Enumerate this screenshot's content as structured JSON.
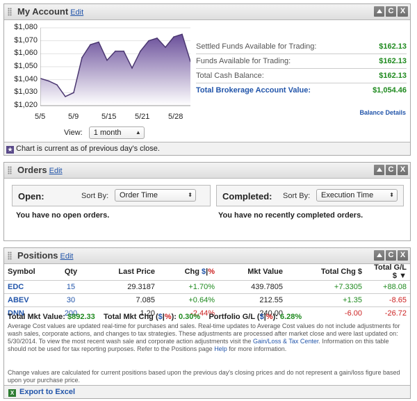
{
  "account": {
    "title": "My Account",
    "edit": "Edit",
    "chart_data": {
      "type": "area",
      "x": [
        "5/5",
        "5/6",
        "5/7",
        "5/8",
        "5/9",
        "5/12",
        "5/13",
        "5/14",
        "5/15",
        "5/16",
        "5/19",
        "5/20",
        "5/21",
        "5/22",
        "5/23",
        "5/27",
        "5/28",
        "5/29",
        "5/30"
      ],
      "values": [
        1041,
        1039,
        1036,
        1027,
        1030,
        1057,
        1067,
        1069,
        1055,
        1062,
        1062,
        1049,
        1062,
        1070,
        1072,
        1065,
        1073,
        1075,
        1054
      ],
      "ylim": [
        1020,
        1080
      ],
      "ytick_labels": [
        "$1,080",
        "$1,070",
        "$1,060",
        "$1,050",
        "$1,040",
        "$1,030",
        "$1,020"
      ],
      "xtick_labels": [
        "5/5",
        "5/9",
        "5/15",
        "5/21",
        "5/28"
      ],
      "fill_color": "#6a4f9a",
      "grid": true
    },
    "view_label": "View:",
    "view_value": "1 month",
    "balances": [
      {
        "label": "Settled Funds Available for Trading:",
        "value": "$162.13"
      },
      {
        "label": "Funds Available for Trading:",
        "value": "$162.13"
      },
      {
        "label": "Total Cash Balance:",
        "value": "$162.13"
      }
    ],
    "total_label": "Total Brokerage Account Value:",
    "total_value": "$1,054.46",
    "balance_details": "Balance Details",
    "footnote": "Chart is current as of previous day's close."
  },
  "orders": {
    "title": "Orders",
    "edit": "Edit",
    "open_label": "Open:",
    "open_sort_label": "Sort By:",
    "open_sort_value": "Order Time",
    "completed_label": "Completed:",
    "completed_sort_label": "Sort By:",
    "completed_sort_value": "Execution Time",
    "open_msg": "You have no open orders.",
    "completed_msg": "You have no recently completed orders."
  },
  "positions": {
    "title": "Positions",
    "edit": "Edit",
    "headers": {
      "symbol": "Symbol",
      "qty": "Qty",
      "last": "Last Price",
      "chg": "Chg",
      "mkt": "Mkt Value",
      "totchg": "Total Chg $",
      "totgl": "Total G/L $"
    },
    "rows": [
      {
        "symbol": "EDC",
        "qty": "15",
        "last": "29.3187",
        "chg": "+1.70%",
        "mkt": "439.7805",
        "totchg": "+7.3305",
        "totgl": "+88.08"
      },
      {
        "symbol": "ABEV",
        "qty": "30",
        "last": "7.085",
        "chg": "+0.64%",
        "mkt": "212.55",
        "totchg": "+1.35",
        "totgl": "-8.65"
      },
      {
        "symbol": "DNN",
        "qty": "200",
        "last": "1.20",
        "chg": "-2.44%",
        "mkt": "240.00",
        "totchg": "-6.00",
        "totgl": "-26.72"
      }
    ],
    "total_mkt_label": "Total Mkt Value:",
    "total_mkt_value": "$892.33",
    "total_chg_label": "Total Mkt Chg",
    "total_chg_value": "0.30%",
    "portfolio_label": "Portfolio G/L",
    "portfolio_value": "6.28%",
    "disclaimer1_a": "Average Cost values are updated real-time for purchases and sales. Real-time updates to Average Cost values do not include adjustments for wash sales, corporate actions, and changes to tax strategies. These adjustments are processed after market close and were last updated on: 5/30/2014. To view the most recent wash sale and corporate action adjustments visit the ",
    "disclaimer1_link1": "Gain/Loss & Tax Center",
    "disclaimer1_b": ". Information on this table should not be used for tax reporting purposes. Refer to the Positions page ",
    "disclaimer1_link2": "Help",
    "disclaimer1_c": " for more information.",
    "disclaimer2": "Change values are calculated for current positions based upon the previous day's closing prices and do not represent a gain/loss figure based upon your purchase price.",
    "export": "Export to Excel"
  }
}
